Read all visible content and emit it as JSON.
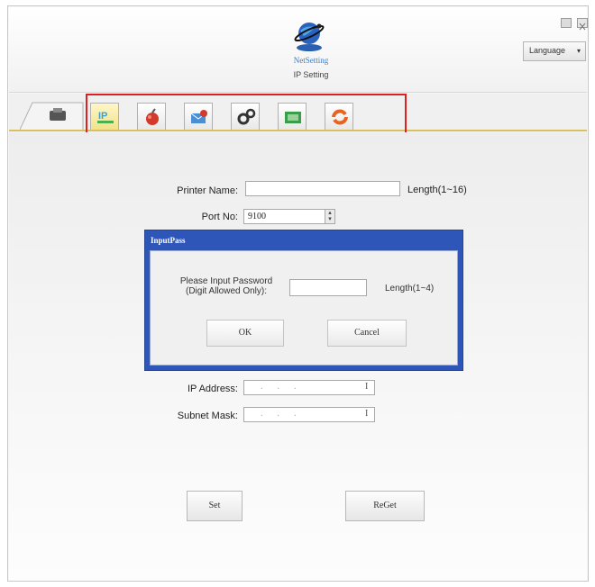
{
  "header": {
    "logo_word": "NetSetting",
    "subtitle": "IP Setting",
    "language_label": "Language"
  },
  "tabs": [
    {
      "icon": "printer-icon"
    },
    {
      "icon": "ip-icon"
    },
    {
      "icon": "bomb-icon"
    },
    {
      "icon": "mail-alert-icon"
    },
    {
      "icon": "gears-icon"
    },
    {
      "icon": "wifi-icon"
    },
    {
      "icon": "refresh-icon"
    }
  ],
  "form": {
    "printer_name_label": "Printer Name:",
    "printer_name_value": "",
    "printer_name_hint": "Length(1~16)",
    "port_label": "Port No:",
    "port_value": "9100",
    "ip_label": "IP Address:",
    "subnet_label": "Subnet Mask:",
    "ip_dots": "...",
    "subnet_dots": "...",
    "set_label": "Set",
    "reget_label": "ReGet"
  },
  "dialog": {
    "title": "InputPass",
    "prompt_line1": "Please Input Password",
    "prompt_line2": "(Digit Allowed Only):",
    "password_value": "",
    "hint": "Length(1~4)",
    "ok_label": "OK",
    "cancel_label": "Cancel"
  },
  "colors": {
    "dialog_frame": "#2e55b8",
    "highlight": "#e02020",
    "logo_blue": "#3a7dc9"
  }
}
